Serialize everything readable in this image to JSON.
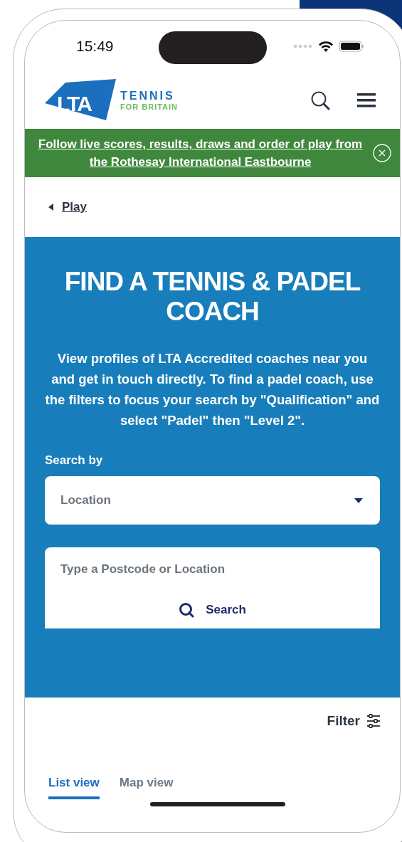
{
  "status_bar": {
    "time": "15:49"
  },
  "header": {
    "logo": {
      "mark": "LTA",
      "line_1": "TENNIS",
      "line_2": "FOR BRITAIN"
    }
  },
  "banner": {
    "link": "Follow live scores, results, draws and order of play from the Rothesay International Eastbourne"
  },
  "breadcrumb": {
    "back_link": "Play"
  },
  "hero": {
    "title": "FIND A TENNIS & PADEL COACH",
    "description": "View profiles of LTA Accredited coaches near you and get in touch directly. To find a padel coach, use the filters to focus your search by \"Qualification\" and select \"Padel\" then \"Level 2\".",
    "search_by_label": "Search by",
    "search_type": {
      "value": "Location"
    },
    "location_field": {
      "placeholder": "Type a Postcode or Location"
    },
    "search_button": "Search"
  },
  "filter": {
    "label": "Filter"
  },
  "view_tabs": [
    {
      "label": "List view",
      "selected": true
    },
    {
      "label": "Map view",
      "selected": false
    }
  ]
}
